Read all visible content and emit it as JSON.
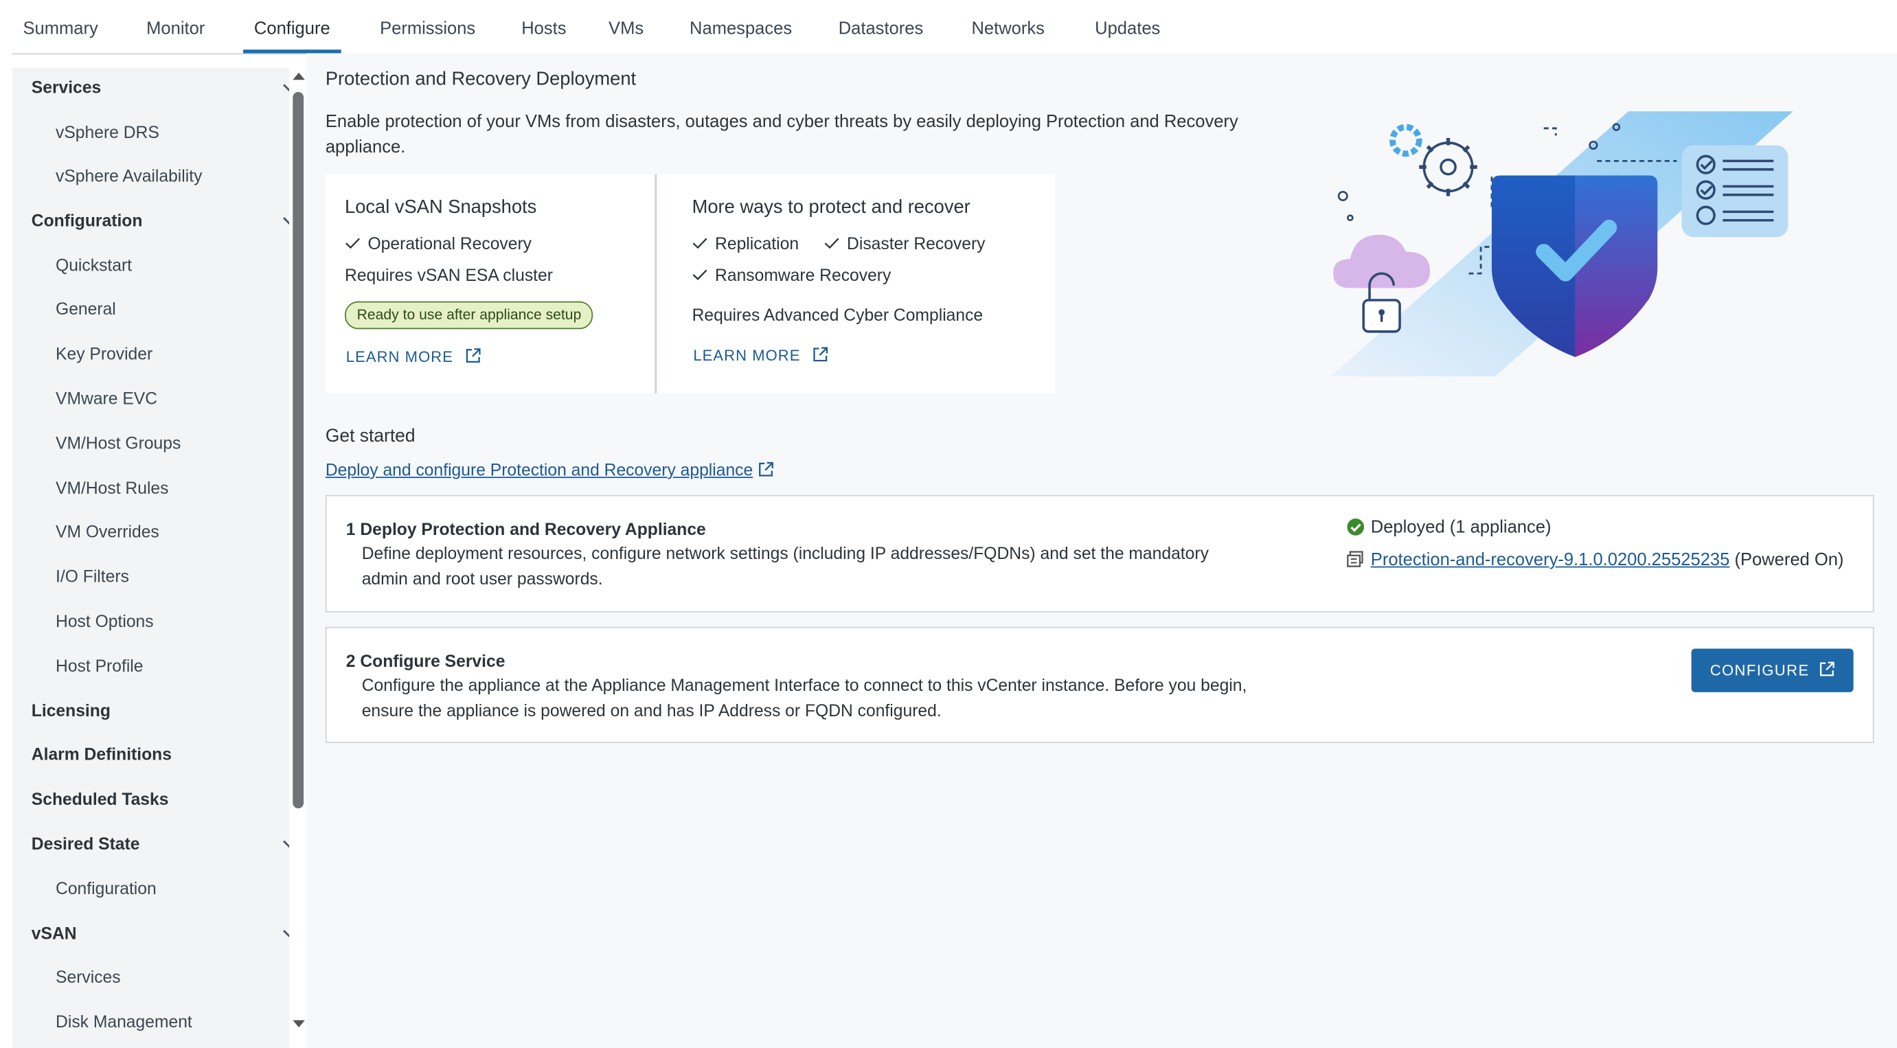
{
  "tabs": [
    "Summary",
    "Monitor",
    "Configure",
    "Permissions",
    "Hosts",
    "VMs",
    "Namespaces",
    "Datastores",
    "Networks",
    "Updates"
  ],
  "sidebar": {
    "services": "Services",
    "drs": "vSphere DRS",
    "availability": "vSphere Availability",
    "configuration": "Configuration",
    "quickstart": "Quickstart",
    "general": "General",
    "key_provider": "Key Provider",
    "evc": "VMware EVC",
    "vm_host_groups": "VM/Host Groups",
    "vm_host_rules": "VM/Host Rules",
    "vm_overrides": "VM Overrides",
    "io_filters": "I/O Filters",
    "host_options": "Host Options",
    "host_profile": "Host Profile",
    "licensing": "Licensing",
    "alarm_definitions": "Alarm Definitions",
    "scheduled_tasks": "Scheduled Tasks",
    "desired_state": "Desired State",
    "ds_configuration": "Configuration",
    "vsan": "vSAN",
    "vsan_services": "Services",
    "disk_management": "Disk Management"
  },
  "main": {
    "title": "Protection and Recovery Deployment",
    "intro": "Enable protection of your VMs from disasters, outages and cyber threats by easily deploying Protection and Recovery appliance.",
    "local_card": {
      "title": "Local vSAN Snapshots",
      "feature": "Operational Recovery",
      "requirement": "Requires vSAN ESA cluster",
      "badge": "Ready to use after appliance setup",
      "learn_more": "LEARN MORE"
    },
    "more_card": {
      "title": "More ways to protect and recover",
      "feature1": "Replication",
      "feature2": "Disaster Recovery",
      "feature3": "Ransomware Recovery",
      "requirement": "Requires Advanced Cyber Compliance",
      "learn_more": "LEARN MORE"
    },
    "get_started": "Get started",
    "deploy_link": "Deploy and configure Protection and Recovery appliance",
    "step1": {
      "title": "1 Deploy Protection and Recovery Appliance",
      "desc_line1": "Define deployment resources, configure network settings (including IP addresses/FQDNs) and set the mandatory",
      "desc_line2": "admin and root user passwords.",
      "status": "Deployed (1 appliance)",
      "appliance": "Protection-and-recovery-9.1.0.0200.25525235",
      "power_state": "(Powered On)"
    },
    "step2": {
      "title": "2 Configure Service",
      "desc_line1": "Configure the appliance at the Appliance Management Interface to connect to this vCenter instance. Before you begin,",
      "desc_line2": "ensure the appliance is powered on and has IP Address or FQDN configured.",
      "button": "CONFIGURE"
    }
  },
  "colors": {
    "accent": "#1b6fb0",
    "link": "#1b5a92",
    "button": "#1f68a8",
    "success": "#3c8a2e"
  }
}
